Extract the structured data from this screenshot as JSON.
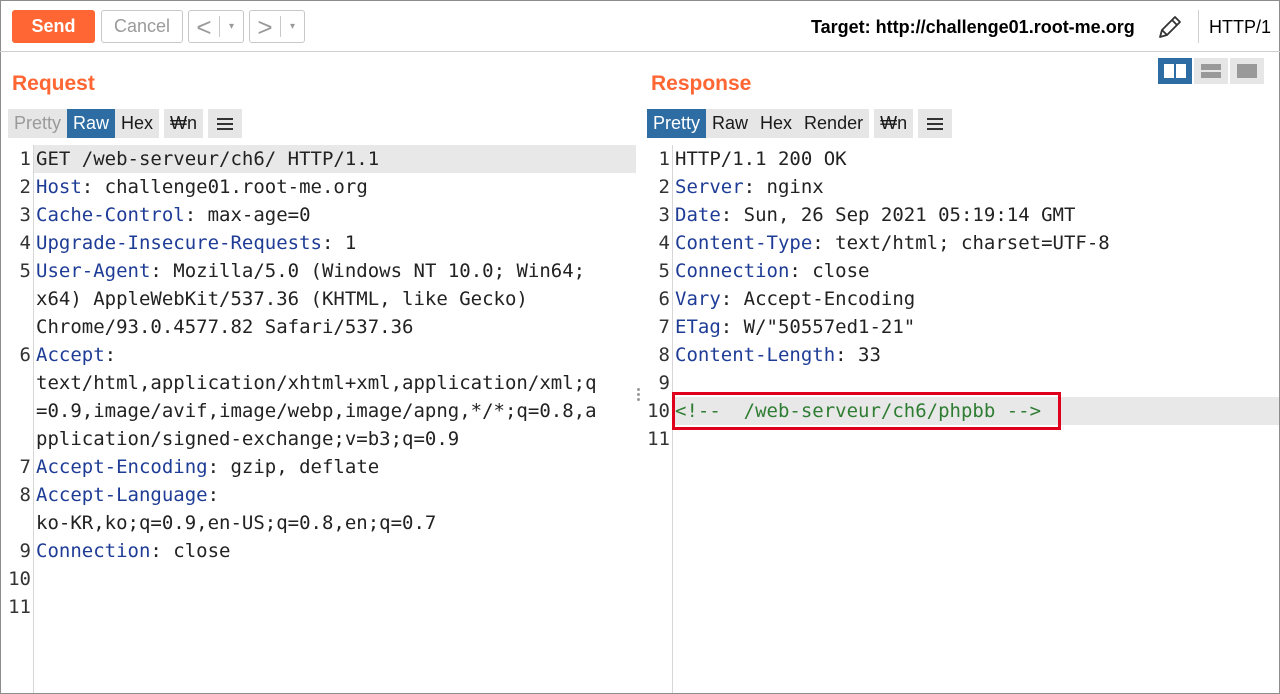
{
  "toolbar": {
    "send_label": "Send",
    "cancel_label": "Cancel",
    "back_arrow": "<",
    "forward_arrow": ">",
    "dropdown_glyph": "▾",
    "target_label": "Target: http://challenge01.root-me.org",
    "protocol_label": "HTTP/1"
  },
  "request": {
    "title": "Request",
    "tabs": [
      "Pretty",
      "Raw",
      "Hex",
      "₩n"
    ],
    "active_tab": "Raw",
    "line_numbers": [
      "1",
      "2",
      "3",
      "4",
      "5",
      "",
      "",
      "6",
      "",
      "",
      "",
      "7",
      "8",
      "",
      "9",
      "10",
      "11"
    ],
    "lines": [
      {
        "key": "GET /web-serveur/ch6/ HTTP/1.1",
        "sep": "",
        "val": ""
      },
      {
        "key": "Host",
        "sep": ": ",
        "val": "challenge01.root-me.org"
      },
      {
        "key": "Cache-Control",
        "sep": ": ",
        "val": "max-age=0"
      },
      {
        "key": "Upgrade-Insecure-Requests",
        "sep": ": ",
        "val": "1"
      },
      {
        "key": "User-Agent",
        "sep": ": ",
        "val": "Mozilla/5.0 (Windows NT 10.0; Win64;"
      },
      {
        "key": "",
        "sep": "",
        "val": "x64) AppleWebKit/537.36 (KHTML, like Gecko)"
      },
      {
        "key": "",
        "sep": "",
        "val": "Chrome/93.0.4577.82 Safari/537.36"
      },
      {
        "key": "Accept",
        "sep": ":",
        "val": ""
      },
      {
        "key": "",
        "sep": "",
        "val": "text/html,application/xhtml+xml,application/xml;q"
      },
      {
        "key": "",
        "sep": "",
        "val": "=0.9,image/avif,image/webp,image/apng,*/*;q=0.8,a"
      },
      {
        "key": "",
        "sep": "",
        "val": "pplication/signed-exchange;v=b3;q=0.9"
      },
      {
        "key": "Accept-Encoding",
        "sep": ": ",
        "val": "gzip, deflate"
      },
      {
        "key": "Accept-Language",
        "sep": ":",
        "val": ""
      },
      {
        "key": "",
        "sep": "",
        "val": "ko-KR,ko;q=0.9,en-US;q=0.8,en;q=0.7"
      },
      {
        "key": "Connection",
        "sep": ": ",
        "val": "close"
      },
      {
        "key": "",
        "sep": "",
        "val": ""
      },
      {
        "key": "",
        "sep": "",
        "val": ""
      }
    ]
  },
  "response": {
    "title": "Response",
    "tabs": [
      "Pretty",
      "Raw",
      "Hex",
      "Render",
      "₩n"
    ],
    "active_tab": "Pretty",
    "line_numbers": [
      "1",
      "2",
      "3",
      "4",
      "5",
      "6",
      "7",
      "8",
      "9",
      "10",
      "11"
    ],
    "lines": [
      {
        "key": "",
        "sep": "",
        "val": "HTTP/1.1 200 OK"
      },
      {
        "key": "Server",
        "sep": ": ",
        "val": "nginx"
      },
      {
        "key": "Date",
        "sep": ": ",
        "val": "Sun, 26 Sep 2021 05:19:14 GMT"
      },
      {
        "key": "Content-Type",
        "sep": ": ",
        "val": "text/html; charset=UTF-8"
      },
      {
        "key": "Connection",
        "sep": ": ",
        "val": "close"
      },
      {
        "key": "Vary",
        "sep": ": ",
        "val": "Accept-Encoding"
      },
      {
        "key": "ETag",
        "sep": ": ",
        "val": "W/\"50557ed1-21\""
      },
      {
        "key": "Content-Length",
        "sep": ": ",
        "val": "33"
      },
      {
        "key": "",
        "sep": "",
        "val": ""
      },
      {
        "comment": "<!--  /web-serveur/ch6/phpbb -->"
      },
      {
        "key": "",
        "sep": "",
        "val": ""
      }
    ]
  },
  "colors": {
    "accent": "#ff6633",
    "tab_active": "#2e6da4",
    "header_key": "#1e3c96",
    "comment": "#2e7d32",
    "highlight_box": "#e0001b"
  }
}
